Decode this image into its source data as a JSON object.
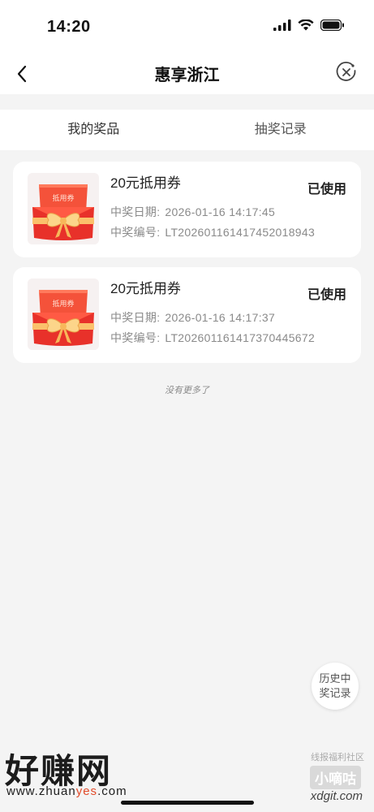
{
  "status_bar": {
    "time": "14:20"
  },
  "nav": {
    "title": "惠享浙江"
  },
  "tabs": [
    {
      "label": "我的奖品"
    },
    {
      "label": "抽奖记录"
    }
  ],
  "prizes": [
    {
      "title": "20元抵用券",
      "status": "已使用",
      "date_label": "中奖日期:",
      "date": "2026-01-16 14:17:45",
      "code_label": "中奖编号:",
      "code": "LT20260116141745​2018943",
      "thumb_text": "抵用券"
    },
    {
      "title": "20元抵用券",
      "status": "已使用",
      "date_label": "中奖日期:",
      "date": "2026-01-16 14:17:37",
      "code_label": "中奖编号:",
      "code": "LT20260116141737​0445672",
      "thumb_text": "抵用券"
    }
  ],
  "footer": {
    "no_more": "没有更多了"
  },
  "history_button": {
    "line1": "历史中",
    "line2": "奖记录"
  },
  "watermark": {
    "left_big": "好赚网",
    "left_url_a": "www.zhuan",
    "left_url_b": "yes",
    "left_url_c": ".com",
    "right_top": "线报福利社区",
    "right_logo": "小嘀咕",
    "right_url": "xdgit.com"
  },
  "icons": {
    "back": "chevron-left-icon",
    "close": "circle-close-icon",
    "signal": "signal-icon",
    "wifi": "wifi-icon",
    "battery": "battery-icon"
  }
}
